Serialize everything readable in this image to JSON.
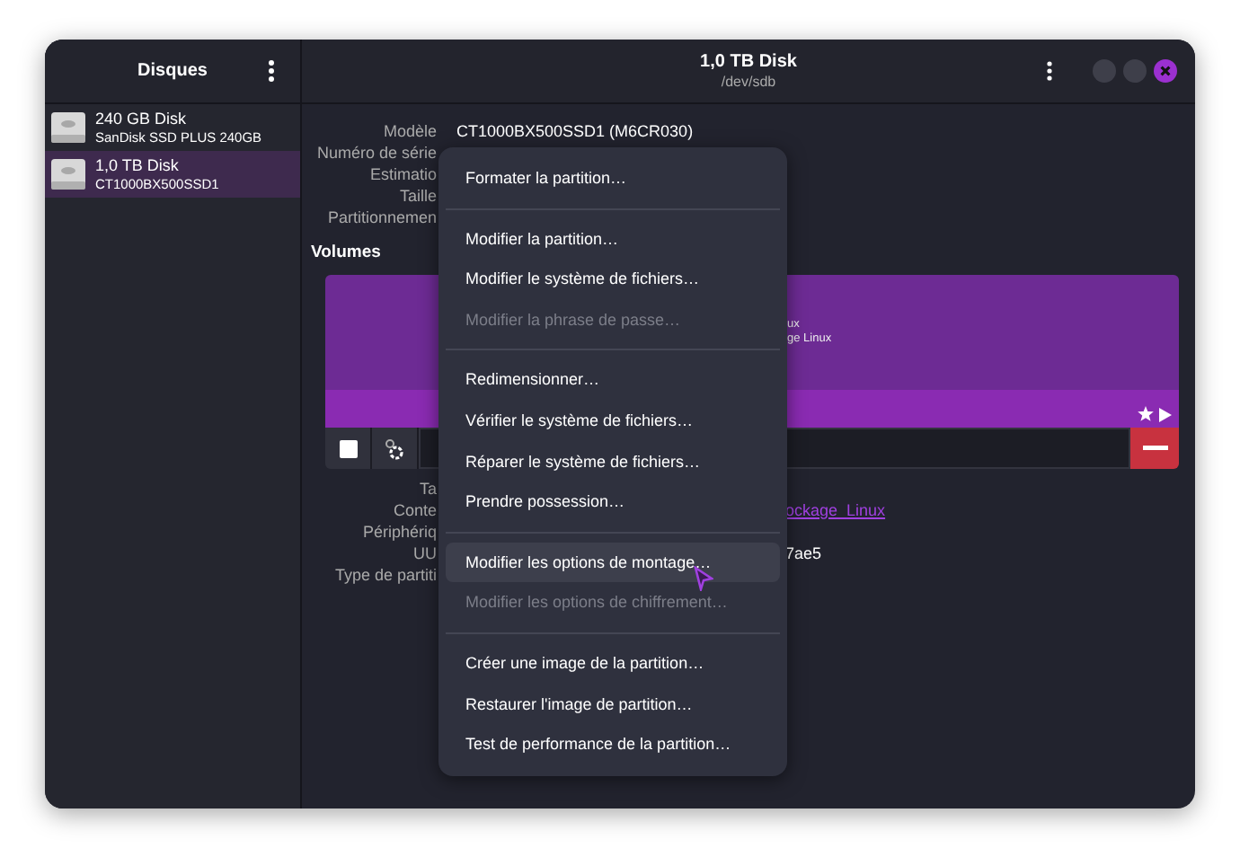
{
  "sidebar": {
    "title": "Disques",
    "disks": [
      {
        "name": "240 GB Disk",
        "model": "SanDisk SSD PLUS 240GB",
        "selected": false
      },
      {
        "name": "1,0 TB Disk",
        "model": "CT1000BX500SSD1",
        "selected": true
      }
    ]
  },
  "header": {
    "title": "1,0 TB Disk",
    "subtitle": "/dev/sdb"
  },
  "details": [
    {
      "label": "Modèle",
      "value": "CT1000BX500SSD1 (M6CR030)"
    },
    {
      "label": "Numéro de série"
    },
    {
      "label": "Estimatio"
    },
    {
      "label": "Taille"
    },
    {
      "label": "Partitionnemen"
    }
  ],
  "volumes": {
    "title": "Volumes",
    "segment_lines": [
      "ux",
      "ge Linux"
    ]
  },
  "partition_details": [
    {
      "label": "Ta"
    },
    {
      "label": "Conte",
      "value": "ockage_Linux",
      "kind": "link"
    },
    {
      "label": "Périphériq"
    },
    {
      "label": "UU",
      "value": "7ae5",
      "kind": "text"
    },
    {
      "label": "Type de partiti"
    }
  ],
  "menu": [
    {
      "label": "Formater la partition…",
      "disabled": false,
      "selected": false,
      "separator_after": true
    },
    {
      "label": "Modifier la partition…",
      "disabled": false,
      "selected": false,
      "separator_after": false
    },
    {
      "label": "Modifier le système de fichiers…",
      "disabled": false,
      "selected": false,
      "separator_after": false
    },
    {
      "label": "Modifier la phrase de passe…",
      "disabled": true,
      "selected": false,
      "separator_after": true
    },
    {
      "label": "Redimensionner…",
      "disabled": false,
      "selected": false,
      "separator_after": false
    },
    {
      "label": "Vérifier le système de fichiers…",
      "disabled": false,
      "selected": false,
      "separator_after": false
    },
    {
      "label": "Réparer le système de fichiers…",
      "disabled": false,
      "selected": false,
      "separator_after": false
    },
    {
      "label": "Prendre possession…",
      "disabled": false,
      "selected": false,
      "separator_after": true
    },
    {
      "label": "Modifier les options de montage…",
      "disabled": false,
      "selected": true,
      "separator_after": false
    },
    {
      "label": "Modifier les options de chiffrement…",
      "disabled": true,
      "selected": false,
      "separator_after": true
    },
    {
      "label": "Créer une image de la partition…",
      "disabled": false,
      "selected": false,
      "separator_after": false
    },
    {
      "label": "Restaurer l'image de partition…",
      "disabled": false,
      "selected": false,
      "separator_after": false
    },
    {
      "label": "Test de performance de la partition…",
      "disabled": false,
      "selected": false,
      "separator_after": false
    }
  ]
}
